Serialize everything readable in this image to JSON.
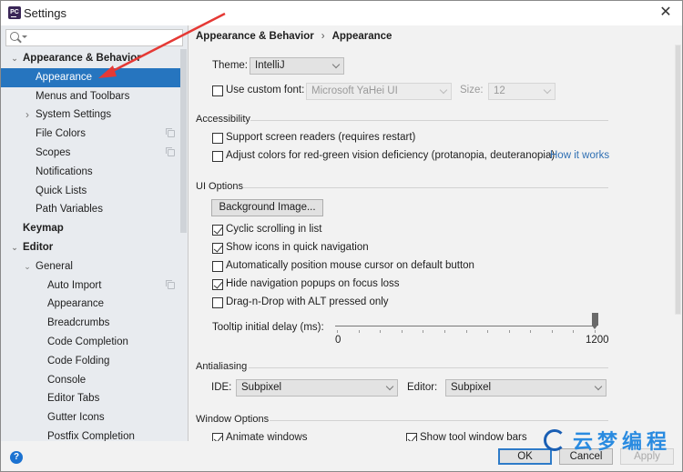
{
  "window": {
    "title": "Settings",
    "app_icon": "pycharm-icon",
    "close_label": "✕"
  },
  "sidebar": {
    "search": {
      "placeholder": "",
      "value": ""
    },
    "items": [
      {
        "label": "Appearance & Behavior",
        "level": 0,
        "expand": "expanded",
        "bold": true,
        "selected": false,
        "copy_icon": false
      },
      {
        "label": "Appearance",
        "level": 1,
        "expand": "none",
        "bold": false,
        "selected": true,
        "copy_icon": false
      },
      {
        "label": "Menus and Toolbars",
        "level": 1,
        "expand": "none",
        "bold": false,
        "selected": false,
        "copy_icon": false
      },
      {
        "label": "System Settings",
        "level": 1,
        "expand": "collapsed",
        "bold": false,
        "selected": false,
        "copy_icon": false
      },
      {
        "label": "File Colors",
        "level": 1,
        "expand": "none",
        "bold": false,
        "selected": false,
        "copy_icon": true
      },
      {
        "label": "Scopes",
        "level": 1,
        "expand": "none",
        "bold": false,
        "selected": false,
        "copy_icon": true
      },
      {
        "label": "Notifications",
        "level": 1,
        "expand": "none",
        "bold": false,
        "selected": false,
        "copy_icon": false
      },
      {
        "label": "Quick Lists",
        "level": 1,
        "expand": "none",
        "bold": false,
        "selected": false,
        "copy_icon": false
      },
      {
        "label": "Path Variables",
        "level": 1,
        "expand": "none",
        "bold": false,
        "selected": false,
        "copy_icon": false
      },
      {
        "label": "Keymap",
        "level": 0,
        "expand": "none",
        "bold": true,
        "selected": false,
        "copy_icon": false
      },
      {
        "label": "Editor",
        "level": 0,
        "expand": "expanded",
        "bold": true,
        "selected": false,
        "copy_icon": false
      },
      {
        "label": "General",
        "level": 1,
        "expand": "expanded",
        "bold": false,
        "selected": false,
        "copy_icon": false
      },
      {
        "label": "Auto Import",
        "level": 2,
        "expand": "none",
        "bold": false,
        "selected": false,
        "copy_icon": true
      },
      {
        "label": "Appearance",
        "level": 2,
        "expand": "none",
        "bold": false,
        "selected": false,
        "copy_icon": false
      },
      {
        "label": "Breadcrumbs",
        "level": 2,
        "expand": "none",
        "bold": false,
        "selected": false,
        "copy_icon": false
      },
      {
        "label": "Code Completion",
        "level": 2,
        "expand": "none",
        "bold": false,
        "selected": false,
        "copy_icon": false
      },
      {
        "label": "Code Folding",
        "level": 2,
        "expand": "none",
        "bold": false,
        "selected": false,
        "copy_icon": false
      },
      {
        "label": "Console",
        "level": 2,
        "expand": "none",
        "bold": false,
        "selected": false,
        "copy_icon": false
      },
      {
        "label": "Editor Tabs",
        "level": 2,
        "expand": "none",
        "bold": false,
        "selected": false,
        "copy_icon": false
      },
      {
        "label": "Gutter Icons",
        "level": 2,
        "expand": "none",
        "bold": false,
        "selected": false,
        "copy_icon": false
      },
      {
        "label": "Postfix Completion",
        "level": 2,
        "expand": "none",
        "bold": false,
        "selected": false,
        "copy_icon": false
      }
    ]
  },
  "main": {
    "breadcrumb": [
      "Appearance & Behavior",
      "Appearance"
    ],
    "breadcrumb_separator": "›",
    "theme": {
      "label": "Theme:",
      "value": "IntelliJ"
    },
    "custom_font": {
      "checkbox_label": "Use custom font:",
      "checked": false,
      "font_value": "Microsoft YaHei UI",
      "size_label": "Size:",
      "size_value": "12"
    },
    "accessibility": {
      "title": "Accessibility",
      "options": [
        {
          "label": "Support screen readers (requires restart)",
          "checked": false
        },
        {
          "label": "Adjust colors for red-green vision deficiency (protanopia, deuteranopia)",
          "checked": false
        }
      ],
      "link": "How it works"
    },
    "ui_options": {
      "title": "UI Options",
      "background_button": "Background Image...",
      "options": [
        {
          "label": "Cyclic scrolling in list",
          "checked": true
        },
        {
          "label": "Show icons in quick navigation",
          "checked": true
        },
        {
          "label": "Automatically position mouse cursor on default button",
          "checked": false
        },
        {
          "label": "Hide navigation popups on focus loss",
          "checked": true
        },
        {
          "label": "Drag-n-Drop with ALT pressed only",
          "checked": false
        }
      ],
      "tooltip_delay": {
        "label": "Tooltip initial delay (ms):",
        "min_label": "0",
        "max_label": "1200",
        "min": 0,
        "max": 1200,
        "value": 1200
      }
    },
    "antialiasing": {
      "title": "Antialiasing",
      "ide_label": "IDE:",
      "ide_value": "Subpixel",
      "editor_label": "Editor:",
      "editor_value": "Subpixel"
    },
    "window_options": {
      "title": "Window Options",
      "options": [
        {
          "label": "Animate windows",
          "checked": true
        },
        {
          "label": "Show tool window bars",
          "checked": true
        }
      ]
    }
  },
  "footer": {
    "help": "?",
    "ok": "OK",
    "cancel": "Cancel",
    "apply": "Apply"
  },
  "overlay": {
    "watermark_text": "云梦编程",
    "arrow_color": "#e53935"
  }
}
